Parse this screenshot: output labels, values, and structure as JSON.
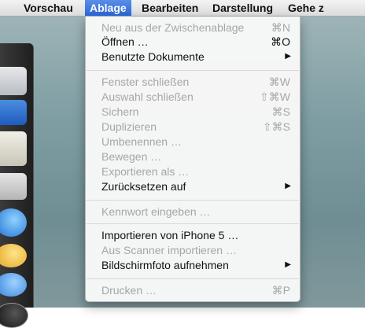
{
  "menubar": {
    "items": [
      "Vorschau",
      "Ablage",
      "Bearbeiten",
      "Darstellung",
      "Gehe z"
    ]
  },
  "menu": {
    "items": [
      {
        "label": "Neu aus der Zwischenablage",
        "shortcut": "⌘N"
      },
      {
        "label": "Öffnen …",
        "shortcut": "⌘O"
      },
      {
        "label": "Benutzte Dokumente",
        "submenu": "▶"
      },
      {
        "label": "Fenster schließen",
        "shortcut": "⌘W"
      },
      {
        "label": "Auswahl schließen",
        "shortcut": "⇧⌘W"
      },
      {
        "label": "Sichern",
        "shortcut": "⌘S"
      },
      {
        "label": "Duplizieren",
        "shortcut": "⇧⌘S"
      },
      {
        "label": "Umbenennen …"
      },
      {
        "label": "Bewegen …"
      },
      {
        "label": "Exportieren als …"
      },
      {
        "label": "Zurücksetzen auf",
        "submenu": "▶"
      },
      {
        "label": "Kennwort eingeben …"
      },
      {
        "label": "Importieren von iPhone 5 …"
      },
      {
        "label": "Aus Scanner importieren …"
      },
      {
        "label": "Bildschirmfoto aufnehmen",
        "submenu": "▶"
      },
      {
        "label": "Drucken …",
        "shortcut": "⌘P"
      }
    ]
  },
  "colors": {
    "highlight": "#2866d8",
    "enabled_text": "#111111",
    "disabled_text": "#a6a6a6"
  }
}
